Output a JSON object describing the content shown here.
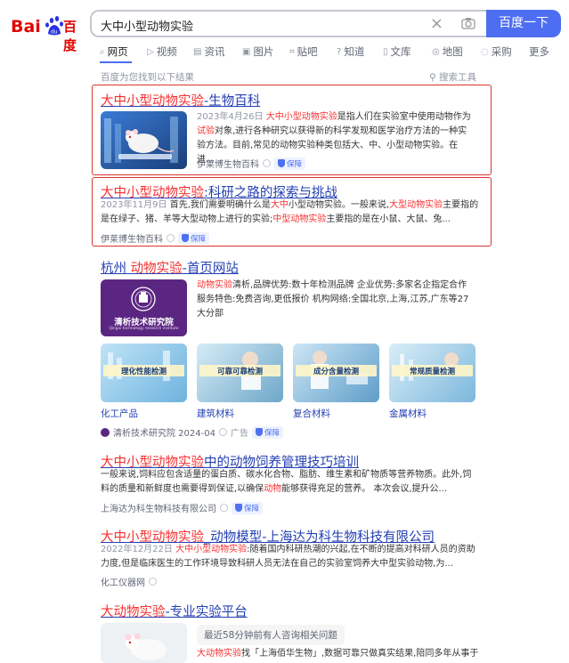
{
  "header": {
    "logo_text": "百度",
    "query": "大中小型动物实验",
    "search_button": "百度一下"
  },
  "tabs": [
    {
      "label": "网页",
      "icon": "search-icon"
    },
    {
      "label": "视频",
      "icon": "video-icon"
    },
    {
      "label": "资讯",
      "icon": "news-icon"
    },
    {
      "label": "图片",
      "icon": "image-icon"
    },
    {
      "label": "贴吧",
      "icon": "tieba-icon"
    },
    {
      "label": "知道",
      "icon": "question-icon"
    },
    {
      "label": "文库",
      "icon": "document-icon"
    },
    {
      "label": "地图",
      "icon": "map-icon"
    },
    {
      "label": "采购",
      "icon": "purchase-icon"
    },
    {
      "label": "更多",
      "icon": ""
    }
  ],
  "summary": "百度为您找到以下结果",
  "tools": "搜索工具",
  "results": [
    {
      "title_hl": "大中小型动物实验",
      "title_rest": "-生物百科",
      "date": "2023年4月26日",
      "abstract_parts": [
        "大中小型动物实验",
        "是指人们在实验室中使用动物作为",
        "试验",
        "对象,进行各种研究以获得新的科学发现和医学治疗方法的一种实验方法。目前,常见的动物实验种类包括大、中、小型动物实验。在进..."
      ],
      "source": "伊莱博生物百科",
      "badge": "保障"
    },
    {
      "title_hl": "大中小型动物实验",
      "title_rest": ":科研之路的探索与挑战",
      "date": "2023年11月9日",
      "abstract_parts": [
        "首先,我们需要明确什么是",
        "大中",
        "小型动物实验。一般来说,",
        "大型动物实验",
        "主要指的是在绿子、猪、羊等大型动物上进行的实验;",
        "中型动物实验",
        "主要指的是在小鼠、大鼠、兔..."
      ],
      "source": "伊莱博生物百科",
      "badge": "保障"
    },
    {
      "title_pre": "杭州 ",
      "title_hl": "动物实验",
      "title_rest": "-首页网站",
      "logo_text": "清析技术研究院",
      "logo_sub": "Qingxi technology research institute",
      "abstract_parts": [
        "动物实验",
        "清析,品牌优势:数十年检测品牌 企业优势:多家名企指定合作服务特色:免费咨询,更低报价 机构网络:全国北京,上海,江苏,广东等27大分部"
      ],
      "images": [
        {
          "banner": "理化性能检测",
          "caption": "化工产品"
        },
        {
          "banner": "可靠可靠检测",
          "caption": "建筑材料"
        },
        {
          "banner": "成分含量检测",
          "caption": "复合材料"
        },
        {
          "banner": "常规质量检测",
          "caption": "金属材料"
        }
      ],
      "source": "清析技术研究院 2024-04",
      "ad": "广告",
      "badge": "保障"
    },
    {
      "title_hl": "大中小型动物实验",
      "title_rest": "中的动物饲养管理技巧培训",
      "abstract_parts": [
        "一般来说,饲料应包含适量的蛋白质、碳水化合物、脂肪、维生素和矿物质等营养物质。此外,饲料的质量和新鲜度也需要得到保证,以确保",
        "动物",
        "能够获得充足的营养。 本次会议,提升公..."
      ],
      "source": "上海达为科生物科技有限公司",
      "badge": "保障"
    },
    {
      "title_hl": "大中小型动物实验",
      "title_rest": "_动物模型-上海达为科生物科技有限公司",
      "date": "2022年12月22日",
      "abstract_parts": [
        "大中小型动物实验",
        ":随着国内科研热潮的兴起,在不断的提高对科研人员的资助力度,但是临床医生的工作环境导致科研人员无法在自己的实验室饲养大中型实验动物,为..."
      ],
      "source": "化工仪器网"
    },
    {
      "title_hl": "大动物实验",
      "title_rest": "-专业实验平台",
      "tag": "最近58分钟前有人咨询相关问题",
      "abstract_parts": [
        "大动物实验",
        "找「上海佰华生物」,数据可靠只做真实结果,陪同多年从事于"
      ]
    }
  ],
  "colors": {
    "accent": "#4e6ef2",
    "link": "#2440b3",
    "highlight": "#f73131",
    "box": "#d9342f"
  }
}
